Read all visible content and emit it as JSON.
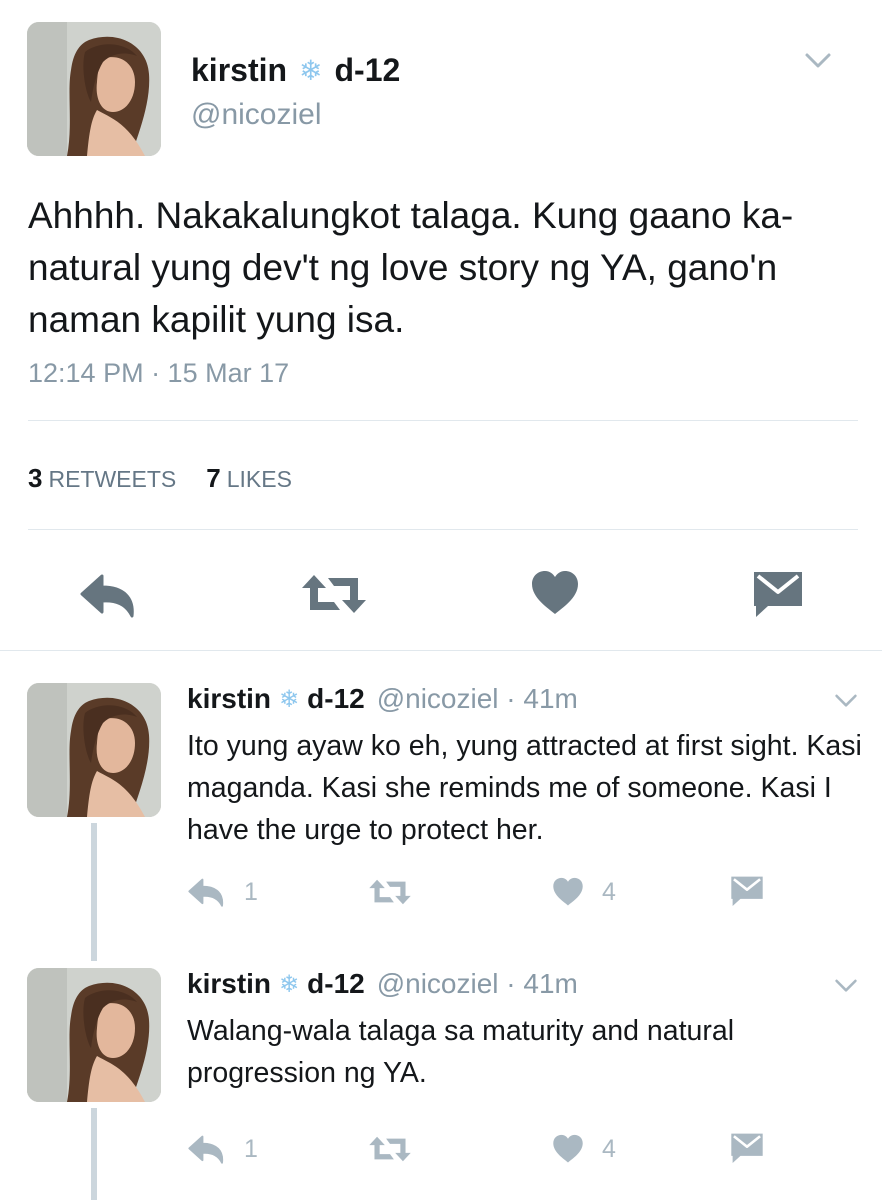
{
  "main_tweet": {
    "display_name_first": "kirstin",
    "display_name_emoji": "❄",
    "display_name_last": "d-12",
    "handle": "@nicoziel",
    "text": "Ahhhh. Nakakalungkot talaga. Kung gaano ka-natural yung dev't ng love story ng YA, gano'n naman kapilit yung isa.",
    "timestamp": "12:14 PM · 15 Mar 17",
    "retweets_count": "3",
    "retweets_label": "RETWEETS",
    "likes_count": "7",
    "likes_label": "LIKES"
  },
  "replies": [
    {
      "display_name_first": "kirstin",
      "display_name_emoji": "❄",
      "display_name_last": "d-12",
      "handle_time": "@nicoziel · 41m",
      "text": "Ito yung ayaw ko eh, yung attracted at first sight. Kasi maganda. Kasi she reminds me of someone. Kasi I have the urge to protect her.",
      "reply_count": "1",
      "like_count": "4"
    },
    {
      "display_name_first": "kirstin",
      "display_name_emoji": "❄",
      "display_name_last": "d-12",
      "handle_time": "@nicoziel · 41m",
      "text": "Walang-wala talaga sa maturity and natural progression ng YA.",
      "reply_count": "1",
      "like_count": "4"
    }
  ],
  "icons": {
    "reply": "reply-icon",
    "retweet": "retweet-icon",
    "like": "heart-icon",
    "message": "direct-message-icon",
    "menu": "chevron-down-icon"
  },
  "colors": {
    "main_icon": "#66757f",
    "reply_icon": "#aab8c2",
    "secondary_text": "#8899a6",
    "snowflake": "#8ec7ee"
  }
}
